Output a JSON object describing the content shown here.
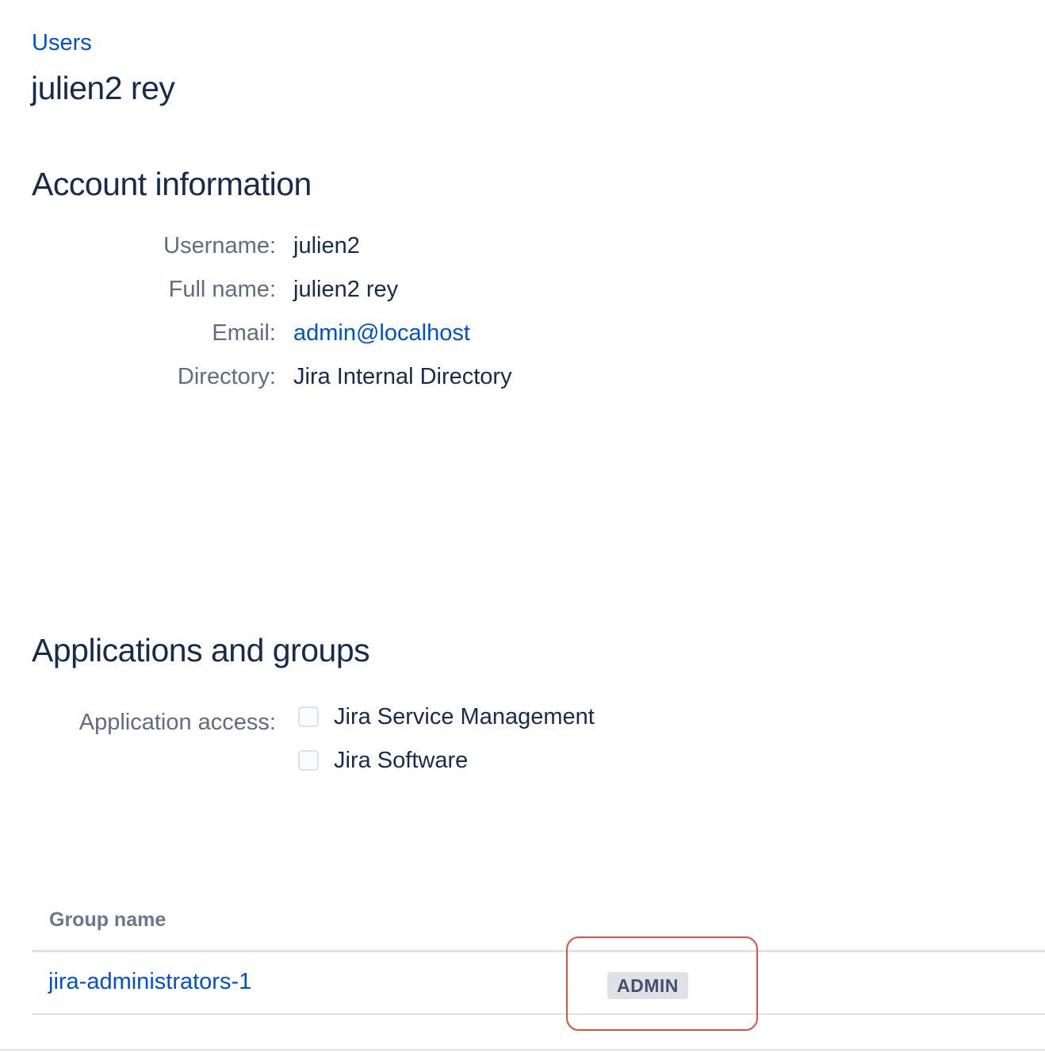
{
  "breadcrumb": {
    "label": "Users"
  },
  "page": {
    "title": "julien2 rey"
  },
  "account": {
    "heading": "Account information",
    "fields": {
      "username": {
        "label": "Username:",
        "value": "julien2"
      },
      "full_name": {
        "label": "Full name:",
        "value": "julien2 rey"
      },
      "email": {
        "label": "Email:",
        "value": "admin@localhost"
      },
      "directory": {
        "label": "Directory:",
        "value": "Jira Internal Directory"
      }
    }
  },
  "applications": {
    "heading": "Applications and groups",
    "access_label": "Application access:",
    "options": [
      {
        "label": "Jira Service Management",
        "checked": false
      },
      {
        "label": "Jira Software",
        "checked": false
      }
    ]
  },
  "groups": {
    "header": "Group name",
    "rows": [
      {
        "name": "jira-administrators-1",
        "badge": "ADMIN"
      }
    ]
  },
  "colors": {
    "link": "#0052cc",
    "text": "#172b4d",
    "label": "#5e6c84",
    "highlight": "#e2503f",
    "badge_bg": "#dfe1e6"
  }
}
